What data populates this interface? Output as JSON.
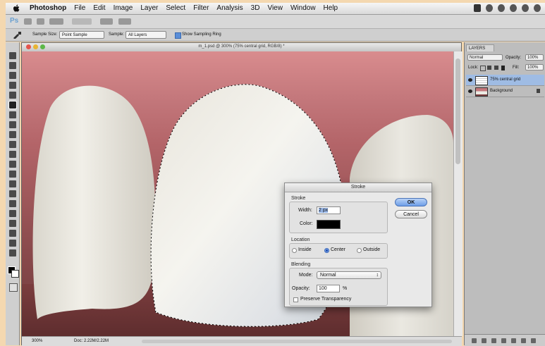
{
  "menubar": {
    "app": "Photoshop",
    "items": [
      "File",
      "Edit",
      "Image",
      "Layer",
      "Select",
      "Filter",
      "Analysis",
      "3D",
      "View",
      "Window",
      "Help"
    ]
  },
  "appbar": {
    "logo": "Ps"
  },
  "options": {
    "sample_size_label": "Sample Size:",
    "sample_size_value": "Point Sample",
    "sample_label": "Sample:",
    "sample_value": "All Layers",
    "show_ring_label": "Show Sampling Ring"
  },
  "document": {
    "title": "m_1.psd @ 300% (75% central grid, RGB/8) *",
    "zoom": "300%",
    "doc_size": "Doc: 2.22M/2.22M"
  },
  "layers": {
    "tab": "LAYERS",
    "blend_mode": "Normal",
    "opacity_label": "Opacity:",
    "opacity_value": "100%",
    "lock_label": "Lock:",
    "fill_label": "Fill:",
    "fill_value": "100%",
    "items": [
      {
        "name": "75% central grid",
        "active": true
      },
      {
        "name": "Background",
        "active": false
      }
    ]
  },
  "stroke_dialog": {
    "title": "Stroke",
    "stroke_group": "Stroke",
    "width_label": "Width:",
    "width_value": "2 px",
    "color_label": "Color:",
    "color_value": "#000000",
    "location_group": "Location",
    "location_options": [
      "Inside",
      "Center",
      "Outside"
    ],
    "location_selected": "Center",
    "blending_group": "Blending",
    "mode_label": "Mode:",
    "mode_value": "Normal",
    "opacity_label": "Opacity:",
    "opacity_value": "100",
    "opacity_unit": "%",
    "preserve_label": "Preserve Transparency",
    "ok_label": "OK",
    "cancel_label": "Cancel"
  },
  "colors": {
    "accent_blue": "#6d9ee8",
    "gum": "#c4787c",
    "tooth": "#ecebe4"
  }
}
